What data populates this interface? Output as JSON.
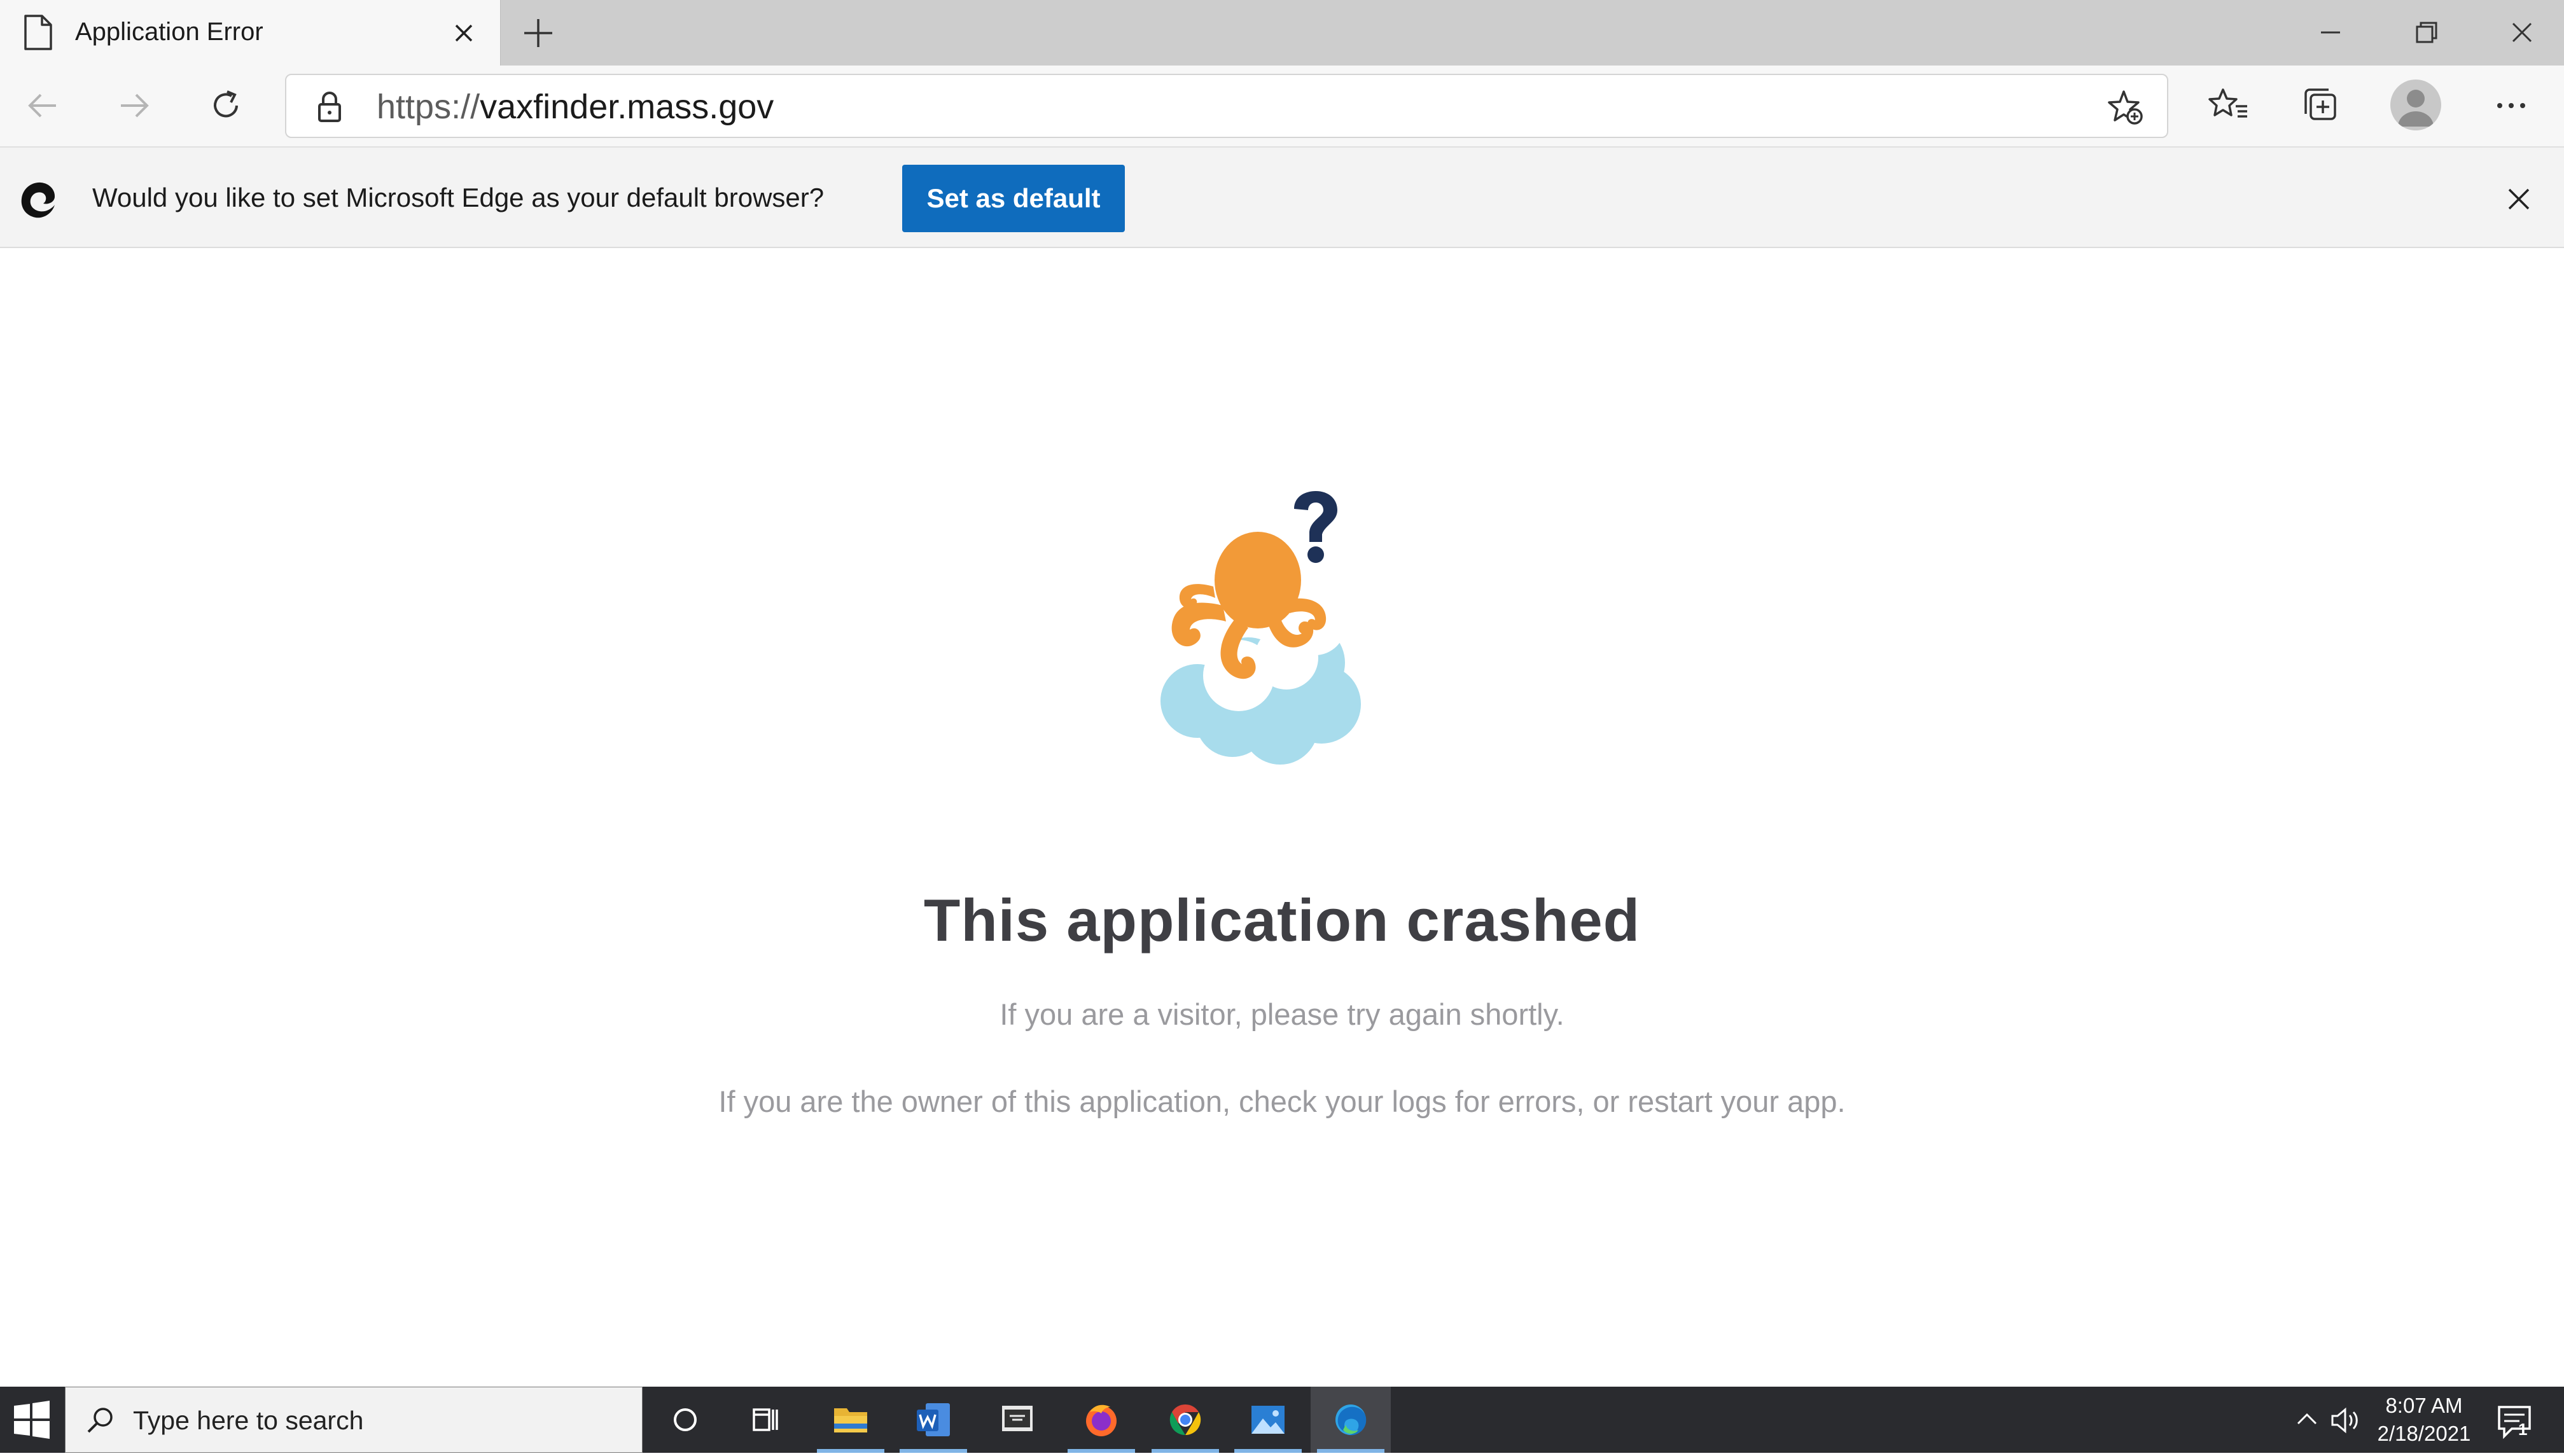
{
  "browser": {
    "tab": {
      "title": "Application Error"
    },
    "address_bar": {
      "scheme": "https://",
      "host": "vaxfinder.mass.gov"
    }
  },
  "infobar": {
    "message": "Would you like to set Microsoft Edge as your default browser?",
    "button_label": "Set as default"
  },
  "page": {
    "title": "This application crashed",
    "visitor_message": "If you are a visitor, please try again shortly.",
    "owner_message": "If you are the owner of this application, check your logs for errors, or restart your app."
  },
  "taskbar": {
    "search_placeholder": "Type here to search",
    "time": "8:07 AM",
    "date": "2/18/2021",
    "notification_count": "1"
  },
  "colors": {
    "accent": "#0f6cbd",
    "mascot_orange": "#f29a38",
    "cloud_blue": "#a8dcec",
    "question_navy": "#1e3157",
    "title_text": "#3f3f44",
    "body_text": "#9a9a9e"
  }
}
